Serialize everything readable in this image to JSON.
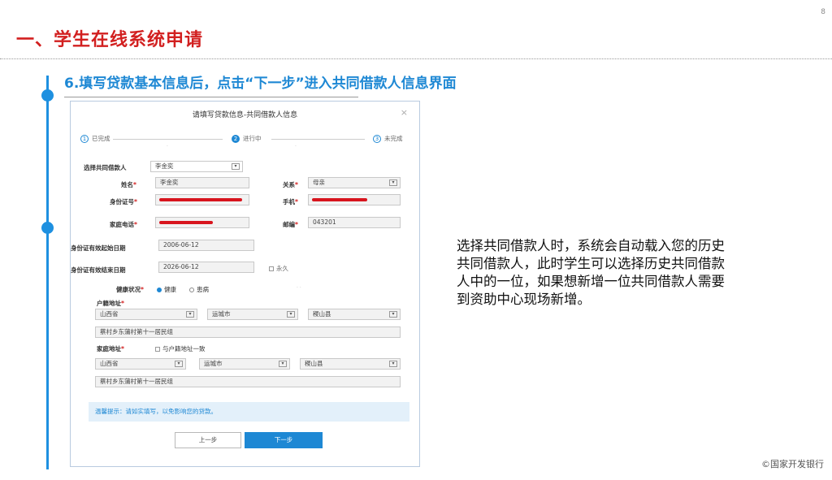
{
  "page_number": "8",
  "main_title": "一、学生在线系统申请",
  "subtitle": "6.填写贷款基本信息后，点击“下一步”进入共同借款人信息界面",
  "description": "选择共同借款人时，系统会自动载入您的历史共同借款人，此时学生可以选择历史共同借款人中的一位，如果想新增一位共同借款人需要到资助中心现场新增。",
  "copyright": "©国家开发银行",
  "colors": {
    "title_red": "#d22020",
    "accent_blue": "#1e88d4",
    "redact_red": "#d8151e"
  },
  "dialog": {
    "title": "请填写贷款信息-共同借款人信息",
    "close_icon": "×",
    "steps": [
      {
        "num": "1",
        "label": "已完成"
      },
      {
        "num": "2",
        "label": "进行中"
      },
      {
        "num": "3",
        "label": "未完成"
      }
    ],
    "select_coborrower": {
      "label": "选择共同借款人",
      "value": "李金奕"
    },
    "name": {
      "label": "姓名",
      "value": "李金奕"
    },
    "relation": {
      "label": "关系",
      "value": "母亲"
    },
    "id_number": {
      "label": "身份证号"
    },
    "phone": {
      "label": "手机"
    },
    "home_phone": {
      "label": "家庭电话"
    },
    "postcode": {
      "label": "邮编",
      "value": "043201"
    },
    "id_start": {
      "label": "身份证有效起始日期",
      "value": "2006-06-12"
    },
    "id_end": {
      "label": "身份证有效结束日期",
      "value": "2026-06-12"
    },
    "permanent": "永久",
    "health": {
      "label": "健康状况",
      "option_healthy": "健康",
      "option_sick": "患病"
    },
    "hukou": {
      "label": "户籍地址",
      "province": "山西省",
      "city": "运城市",
      "county": "稷山县",
      "detail": "蔡村乡东蒲村第十一居民组"
    },
    "home_address": {
      "label": "家庭地址",
      "same_as_hukou": "与户籍地址一致",
      "province": "山西省",
      "city": "运城市",
      "county": "稷山县",
      "detail": "蔡村乡东蒲村第十一居民组"
    },
    "tip": "温馨提示：请如实填写，以免影响您的贷款。",
    "prev_button": "上一步",
    "next_button": "下一步"
  }
}
